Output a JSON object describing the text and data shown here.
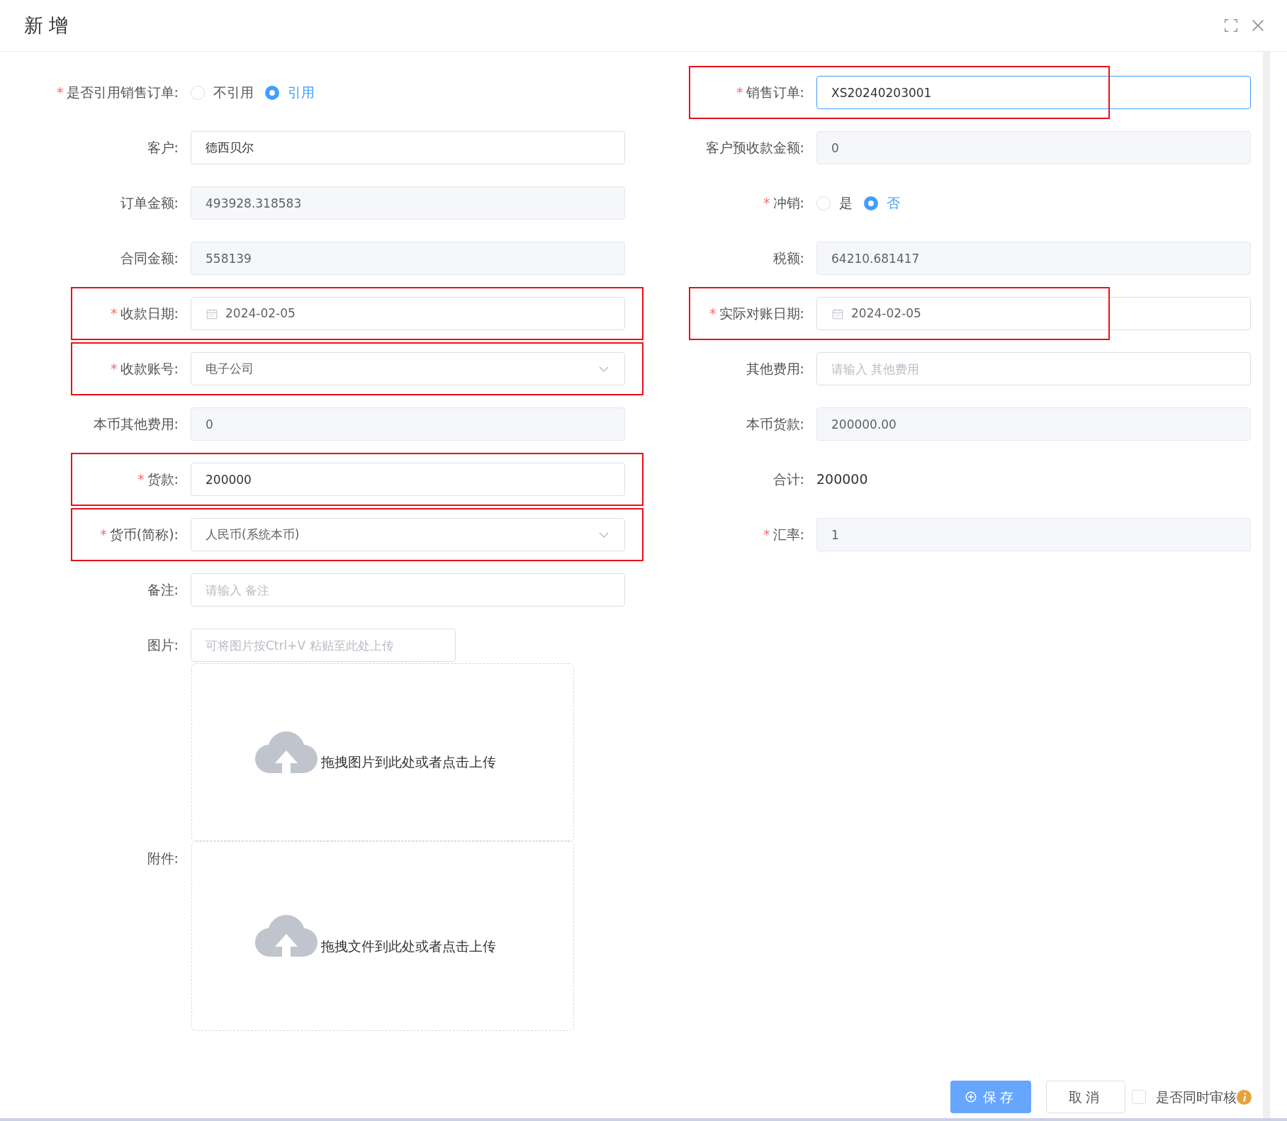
{
  "dialog": {
    "title": "新增"
  },
  "rows": [
    {
      "items": [
        {
          "mark": "*",
          "label": "是否引用销售订单:",
          "kind": "radio",
          "highlighted": false,
          "options": [
            {
              "label": "不引用",
              "selected": false
            },
            {
              "label": "引用",
              "selected": true
            }
          ]
        },
        {
          "mark": "*",
          "label": "销售订单:",
          "kind": "input",
          "value": "XS20240203001",
          "disabled": false,
          "focused": true,
          "highlighted": true
        }
      ]
    },
    {
      "items": [
        {
          "label": "客户:",
          "kind": "input",
          "value": "德西贝尔",
          "disabled": false,
          "focused": false,
          "highlighted": false
        },
        {
          "label": "客户预收款金额:",
          "kind": "input",
          "value": "0",
          "disabled": true,
          "focused": false,
          "highlighted": false
        }
      ]
    },
    {
      "items": [
        {
          "label": "订单金额:",
          "kind": "input",
          "value": "493928.318583",
          "disabled": true,
          "focused": false,
          "highlighted": false
        },
        {
          "mark": "*",
          "label": "冲销:",
          "kind": "radio",
          "highlighted": false,
          "options": [
            {
              "label": "是",
              "selected": false
            },
            {
              "label": "否",
              "selected": true
            }
          ]
        }
      ]
    },
    {
      "items": [
        {
          "label": "合同金额:",
          "kind": "input",
          "value": "558139",
          "disabled": true,
          "focused": false,
          "highlighted": false
        },
        {
          "label": "税额:",
          "kind": "input",
          "value": "64210.681417",
          "disabled": true,
          "focused": false,
          "highlighted": false
        }
      ]
    },
    {
      "items": [
        {
          "mark": "*",
          "label": "收款日期:",
          "kind": "date",
          "value": "2024-02-05",
          "highlighted": true
        },
        {
          "mark": "*",
          "label": "实际对账日期:",
          "kind": "date",
          "value": "2024-02-05",
          "highlighted": true
        }
      ]
    },
    {
      "items": [
        {
          "mark": "*",
          "label": "收款账号:",
          "kind": "select",
          "value": "电子公司",
          "highlighted": true
        },
        {
          "label": "其他费用:",
          "kind": "input",
          "placeholder": "请输入 其他费用",
          "highlighted": false
        }
      ]
    },
    {
      "items": [
        {
          "label": "本币其他费用:",
          "kind": "input",
          "value": "0",
          "disabled": true,
          "focused": false,
          "highlighted": false
        },
        {
          "label": "本币货款:",
          "kind": "input",
          "value": "200000.00",
          "disabled": true,
          "focused": false,
          "highlighted": false
        }
      ]
    },
    {
      "items": [
        {
          "mark": "*",
          "label": "货款:",
          "kind": "input",
          "value": "200000",
          "disabled": false,
          "focused": false,
          "highlighted": true
        },
        {
          "label": "合计:",
          "kind": "static",
          "value": "200000",
          "highlighted": false
        }
      ]
    },
    {
      "items": [
        {
          "mark": "*",
          "label": "货币(简称):",
          "kind": "select",
          "value": "人民币(系统本币)",
          "highlighted": true
        },
        {
          "mark": "*",
          "label": "汇率:",
          "kind": "input",
          "value": "1",
          "disabled": true,
          "focused": false,
          "highlighted": false
        }
      ]
    },
    {
      "items": [
        {
          "label": "备注:",
          "kind": "input",
          "placeholder": "请输入 备注",
          "highlighted": false
        }
      ]
    }
  ],
  "uploads": [
    {
      "label": "图片:",
      "paste_placeholder": "可将图片按Ctrl+V 粘贴至此处上传",
      "hint": "拖拽图片到此处或者点击上传"
    },
    {
      "label": "附件:",
      "hint": "拖拽文件到此处或者点击上传"
    }
  ],
  "buttons": [
    {
      "label": "保存",
      "kind": "primary"
    },
    {
      "label": "取消",
      "kind": "default"
    }
  ],
  "audit": {
    "label": "是否同时审核",
    "checked": false
  }
}
